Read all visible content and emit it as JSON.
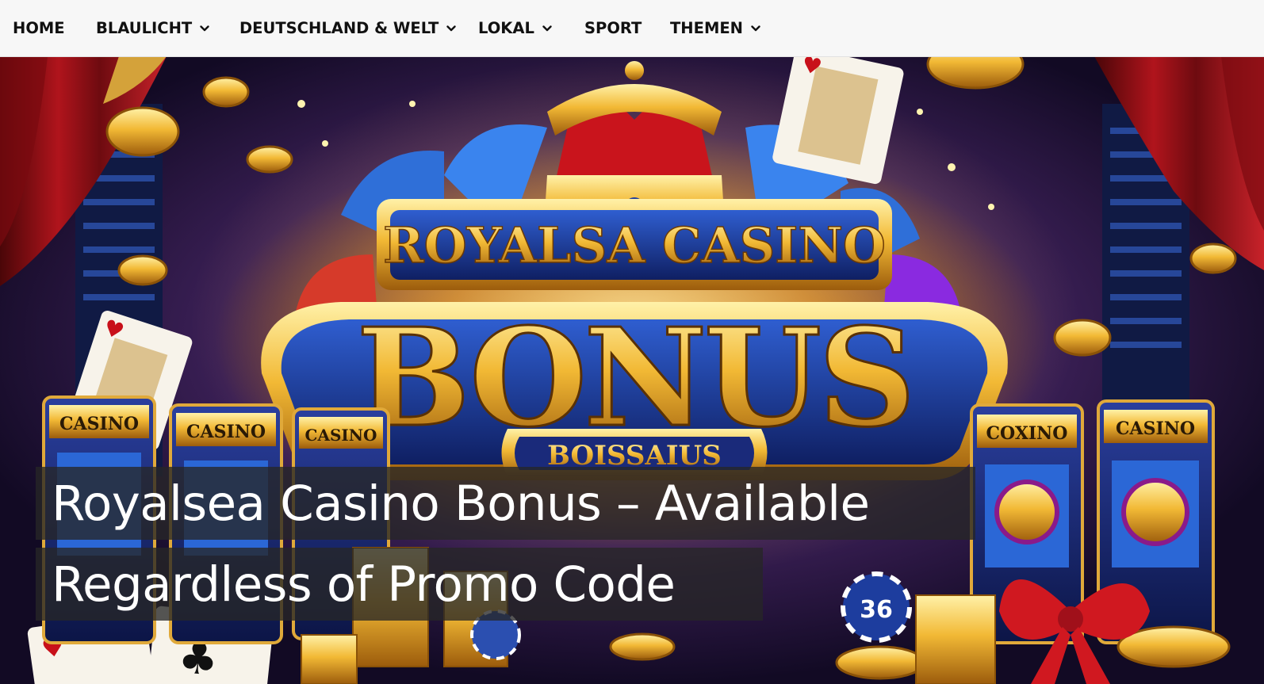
{
  "nav": {
    "items": [
      {
        "label": "HOME",
        "has_dropdown": false
      },
      {
        "label": "BLAULICHT",
        "has_dropdown": true
      },
      {
        "label": "DEUTSCHLAND & WELT",
        "has_dropdown": true
      },
      {
        "label": "LOKAL",
        "has_dropdown": true
      },
      {
        "label": "SPORT",
        "has_dropdown": false
      },
      {
        "label": "THEMEN",
        "has_dropdown": true
      }
    ]
  },
  "hero": {
    "image_text": {
      "top_banner": "ROYALSA CASINO",
      "main_word": "BONUS",
      "sub_banner": "BOISSAIUS",
      "slot_machine_labels": [
        "CASINO",
        "CASINO",
        "CASINO",
        "COXINO",
        "CASINO"
      ],
      "chip_number": "36"
    },
    "headline": {
      "line1": "Royalsea Casino Bonus – Available",
      "line2": "Regardless of Promo Code"
    }
  },
  "colors": {
    "nav_background": "#f7f7f7",
    "nav_text": "#111111",
    "headline_overlay": "#262626",
    "headline_text": "#ffffff",
    "gold": "#f2b935",
    "royal_blue": "#1d3d9e"
  }
}
